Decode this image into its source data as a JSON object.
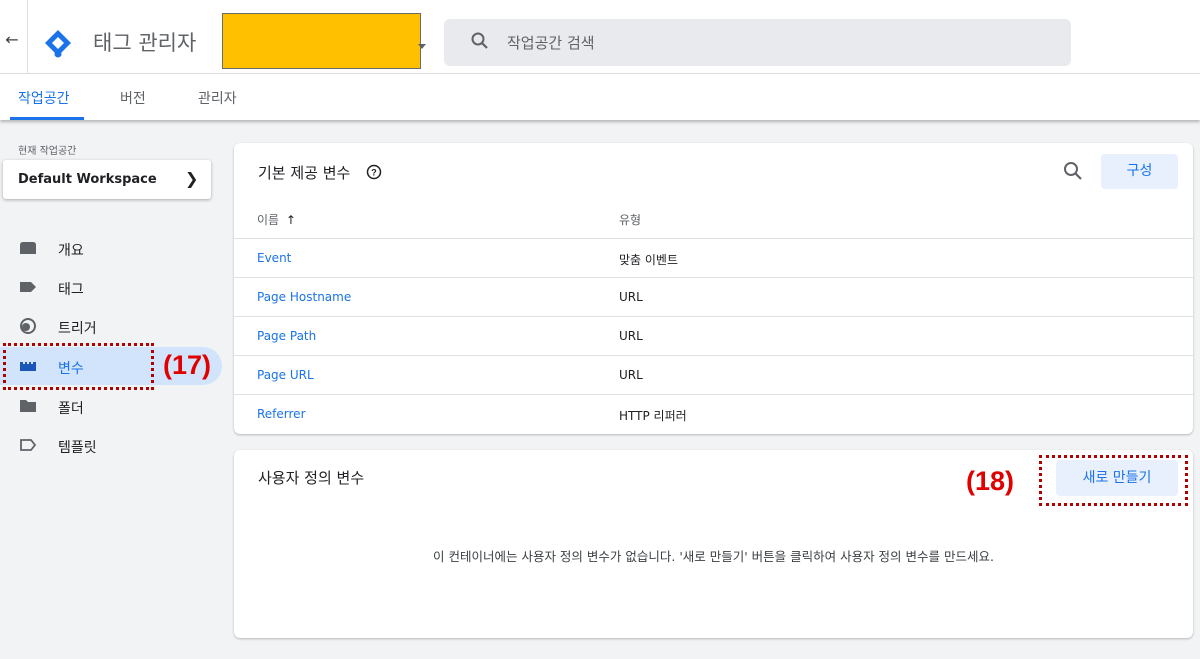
{
  "header": {
    "back_icon": "arrow-left-icon",
    "app_title": "태그 관리자",
    "search_placeholder": "작업공간 검색",
    "logo_color": "#1a73e8",
    "redacted_account_color": "#ffc000"
  },
  "tabs": [
    {
      "label": "작업공간",
      "active": true
    },
    {
      "label": "버전",
      "active": false
    },
    {
      "label": "관리자",
      "active": false
    }
  ],
  "workspace": {
    "label": "현재 작업공간",
    "name": "Default Workspace"
  },
  "sidebar": {
    "items": [
      {
        "label": "개요",
        "icon": "overview-icon",
        "active": false
      },
      {
        "label": "태그",
        "icon": "tag-icon",
        "active": false
      },
      {
        "label": "트리거",
        "icon": "trigger-icon",
        "active": false
      },
      {
        "label": "변수",
        "icon": "variable-icon",
        "active": true
      },
      {
        "label": "폴더",
        "icon": "folder-icon",
        "active": false
      },
      {
        "label": "템플릿",
        "icon": "template-icon",
        "active": false
      }
    ]
  },
  "annotations": {
    "variables_marker": "(17)",
    "new_button_marker": "(18)",
    "marker_color": "#e00000"
  },
  "builtin": {
    "title": "기본 제공 변수",
    "configure_label": "구성",
    "columns": {
      "name": "이름",
      "sort_icon": "arrow-up-icon",
      "type": "유형"
    },
    "rows": [
      {
        "name": "Event",
        "type": "맞춤 이벤트"
      },
      {
        "name": "Page Hostname",
        "type": "URL"
      },
      {
        "name": "Page Path",
        "type": "URL"
      },
      {
        "name": "Page URL",
        "type": "URL"
      },
      {
        "name": "Referrer",
        "type": "HTTP 리퍼러"
      }
    ]
  },
  "user_defined": {
    "title": "사용자 정의 변수",
    "new_label": "새로 만들기",
    "empty_message": "이 컨테이너에는 사용자 정의 변수가 없습니다. '새로 만들기' 버튼을 클릭하여 사용자 정의 변수를 만드세요."
  }
}
